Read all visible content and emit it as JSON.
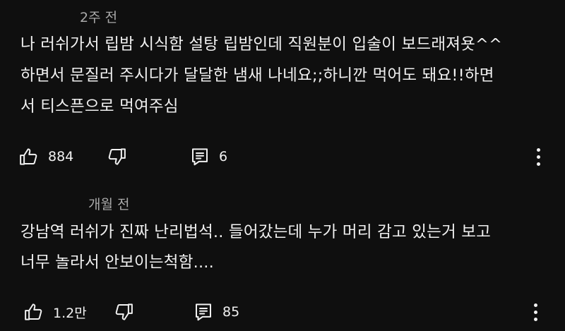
{
  "comments": [
    {
      "time": "2주 전",
      "text": "나 러쉬가서 립밤 시식함 설탕 립밤인데 직원분이 입술이 보드래져욧^^\n하면서 문질러 주시다가 달달한 냄새 나네요;;하니깐 먹어도 돼요!!하면\n서 티스픈으로 먹여주심",
      "likes": "884",
      "replies": "6"
    },
    {
      "time": "개월 전",
      "text": "강남역 러쉬가 진짜 난리법석.. 들어갔는데 누가 머리 감고 있는거 보고\n너무 놀라서 안보이는척함....",
      "likes": "1.2만",
      "replies": "85"
    }
  ],
  "icons": {
    "like": "thumbs-up-icon",
    "dislike": "thumbs-down-icon",
    "reply": "reply-comment-icon",
    "more": "more-vertical-icon"
  },
  "colors": {
    "background": "#0f0f0f",
    "text": "#f1f1f1",
    "secondary_text": "#aaaaaa"
  }
}
